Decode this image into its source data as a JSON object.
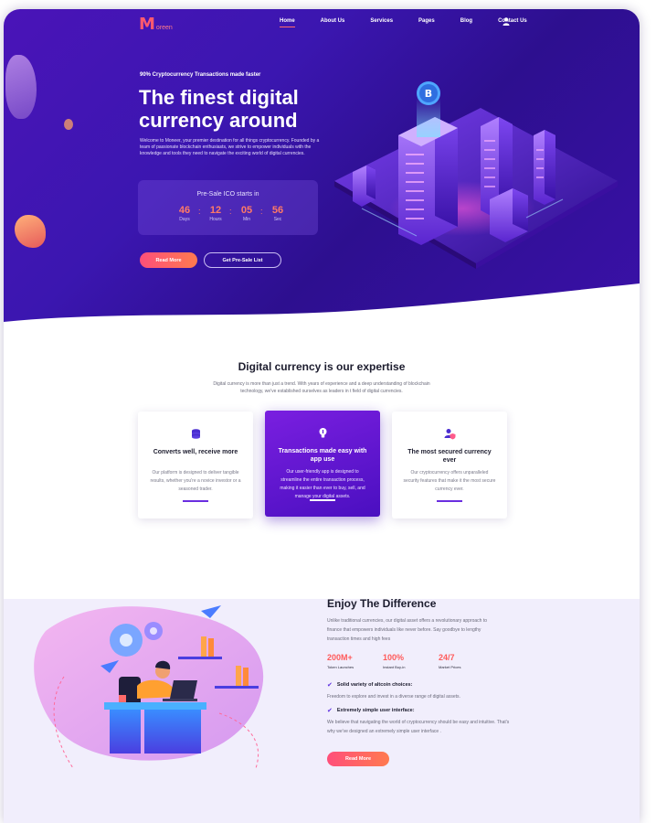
{
  "brand": {
    "logo_mark": "M",
    "logo_text": "oreen"
  },
  "nav": {
    "items": [
      {
        "label": "Home",
        "active": true
      },
      {
        "label": "About Us"
      },
      {
        "label": "Services"
      },
      {
        "label": "Pages"
      },
      {
        "label": "Blog"
      },
      {
        "label": "Contact Us"
      }
    ],
    "user_icon": "user-icon"
  },
  "hero": {
    "kicker": "90% Cryptocurrency Transactions made faster",
    "title": "The finest digital currency around",
    "description": "Welcome to Moneer, your premier destination for all things cryptocurrency. Founded by a team of passionate blockchain enthusiasts, we strive to empower individuals with the knowledge and tools they need to navigate the exciting world of digital currencies.",
    "countdown": {
      "title": "Pre-Sale ICO starts in",
      "units": [
        {
          "value": "46",
          "label": "Days"
        },
        {
          "value": "12",
          "label": "Hours"
        },
        {
          "value": "05",
          "label": "Min"
        },
        {
          "value": "56",
          "label": "Sec"
        }
      ]
    },
    "primary_button": "Read More",
    "secondary_button": "Get  Pre-Sale List",
    "illustration_badge": "B"
  },
  "expertise": {
    "title": "Digital currency is our expertise",
    "description": "Digital currency is more than just a trend. With years of experience and a deep understanding of blockchain technology, we've established ourselves as leaders in t field of digital currencies.",
    "cards": [
      {
        "icon": "coins-icon",
        "title": "Converts well, receive more",
        "text": "Our platform is designed to deliver tangible results, whether you're a novice investor or a seasoned trader.",
        "highlighted": false
      },
      {
        "icon": "lightbulb-icon",
        "title": "Transactions made easy with app use",
        "text": "Our user-friendly app is designed to streamline the entire transaction process, making it easier than ever to buy, sell, and manage your digital assets.",
        "highlighted": true
      },
      {
        "icon": "secure-user-icon",
        "title": "The most secured currency ever",
        "text": "Our cryptocurrency offers unparalleled security features that make it the most secure currency ever.",
        "highlighted": false
      }
    ]
  },
  "difference": {
    "title": "Enjoy The Difference",
    "description": "Unlike traditional currencies, our digital asset offers a revolutionary approach to finance that empowers individuals like never before. Say goodbye to lengthy transaction times and high fees",
    "stats": [
      {
        "value": "200M+",
        "label": "Token Launches"
      },
      {
        "value": "100%",
        "label": "Instant Buy-in"
      },
      {
        "value": "24/7",
        "label": "Market Prices"
      }
    ],
    "features": [
      {
        "title": "Solid variety of altcoin choices:",
        "text": "Freedom to explore and invest in a diverse range of digital assets."
      },
      {
        "title": "Extremely simple user interface:",
        "text": "We believe that navigating the world of cryptocurrency should be easy and intuitive. That's why we've designed an extremely simple user interface ."
      }
    ],
    "button": "Read More"
  },
  "colors": {
    "hero_start": "#4a14b8",
    "hero_end": "#2d0f8f",
    "accent": "#ff5a6e",
    "card_highlight": "#5b16d0",
    "section_bg": "#f1eefc"
  }
}
